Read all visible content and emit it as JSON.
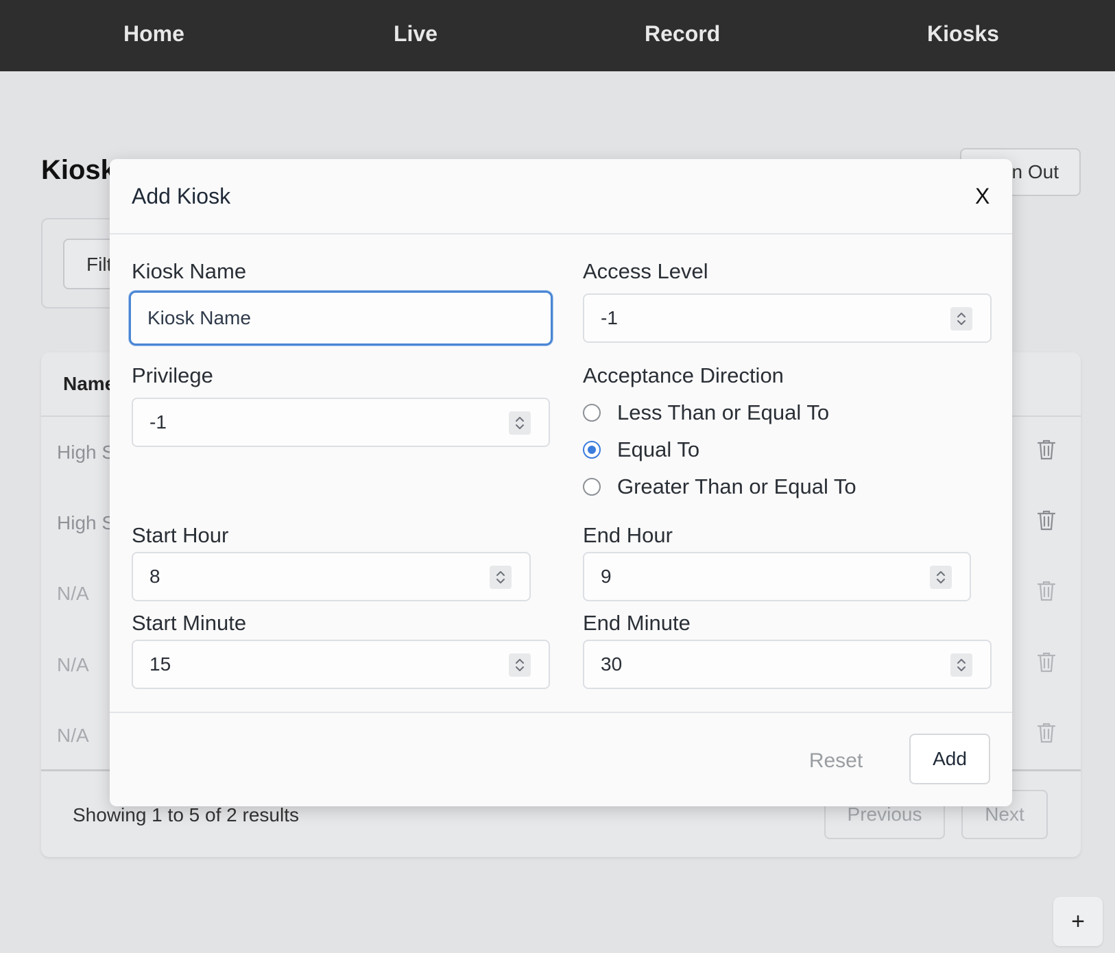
{
  "nav": {
    "items": [
      {
        "label": "Home"
      },
      {
        "label": "Live"
      },
      {
        "label": "Record"
      },
      {
        "label": "Kiosks"
      }
    ]
  },
  "page": {
    "title": "Kiosk",
    "signout_label": "n Out",
    "filter_label": "Filt",
    "table_header_name": "Name",
    "rows": [
      {
        "name": "High S"
      },
      {
        "name": "High S"
      },
      {
        "name": "N/A"
      },
      {
        "name": "N/A"
      },
      {
        "name": "N/A"
      }
    ],
    "showing_text": "Showing 1 to 5 of 2 results",
    "previous_label": "Previous",
    "next_label": "Next",
    "fab_label": "+"
  },
  "modal": {
    "title": "Add Kiosk",
    "close_label": "X",
    "kiosk_name": {
      "label": "Kiosk Name",
      "value": "",
      "placeholder": "Kiosk Name"
    },
    "access_level": {
      "label": "Access Level",
      "value": "-1"
    },
    "privilege": {
      "label": "Privilege",
      "value": "-1"
    },
    "acceptance_direction": {
      "label": "Acceptance Direction",
      "options": [
        {
          "label": "Less Than or Equal To",
          "checked": false
        },
        {
          "label": "Equal To",
          "checked": true
        },
        {
          "label": "Greater Than or Equal To",
          "checked": false
        }
      ]
    },
    "start_hour": {
      "label": "Start Hour",
      "value": "8"
    },
    "end_hour": {
      "label": "End Hour",
      "value": "9"
    },
    "start_minute": {
      "label": "Start Minute",
      "value": "15"
    },
    "end_minute": {
      "label": "End Minute",
      "value": "30"
    },
    "reset_label": "Reset",
    "add_label": "Add"
  },
  "colors": {
    "nav_bg": "#2e2e2e",
    "accent": "#3b7ddd",
    "backdrop": "#e2e3e5"
  }
}
